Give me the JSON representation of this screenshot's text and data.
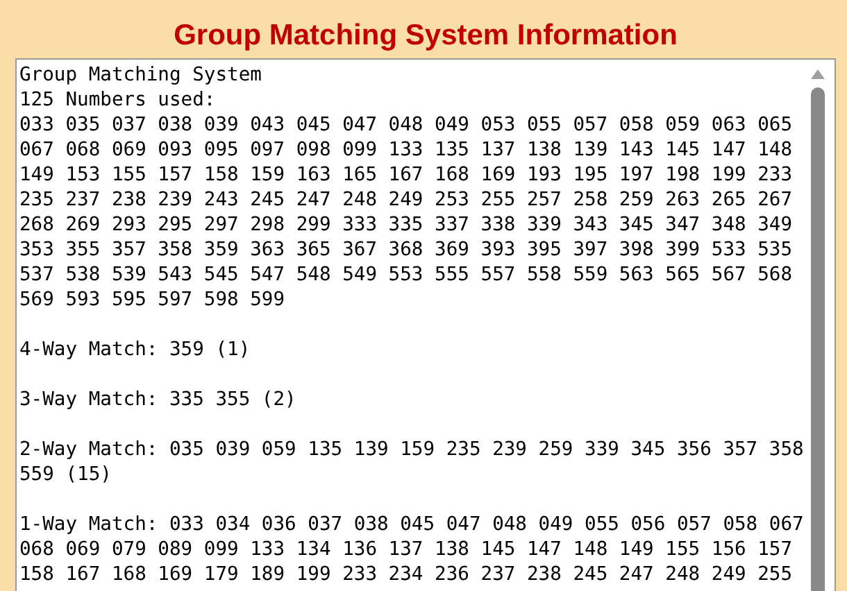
{
  "title": "Group Matching System Information",
  "output": {
    "blocks": [
      {
        "lines": [
          "Group Matching System",
          "125 Numbers used:",
          "033 035 037 038 039 043 045 047 048 049 053 055 057 058 059 063 065",
          "067 068 069 093 095 097 098 099 133 135 137 138 139 143 145 147 148",
          "149 153 155 157 158 159 163 165 167 168 169 193 195 197 198 199 233",
          "235 237 238 239 243 245 247 248 249 253 255 257 258 259 263 265 267",
          "268 269 293 295 297 298 299 333 335 337 338 339 343 345 347 348 349",
          "353 355 357 358 359 363 365 367 368 369 393 395 397 398 399 533 535",
          "537 538 539 543 545 547 548 549 553 555 557 558 559 563 565 567 568",
          "569 593 595 597 598 599"
        ]
      },
      {
        "lines": [
          "4-Way Match: 359 (1)"
        ]
      },
      {
        "lines": [
          "3-Way Match: 335 355 (2)"
        ]
      },
      {
        "lines": [
          "2-Way Match: 035 039 059 135 139 159 235 239 259 339 345 356 357 358",
          "559 (15)"
        ]
      },
      {
        "lines": [
          "1-Way Match: 033 034 036 037 038 045 047 048 049 055 056 057 058 067",
          "068 069 079 089 099 133 134 136 137 138 145 147 148 149 155 156 157",
          "158 167 168 169 179 189 199 233 234 236 237 238 245 247 248 249 255"
        ]
      }
    ]
  }
}
